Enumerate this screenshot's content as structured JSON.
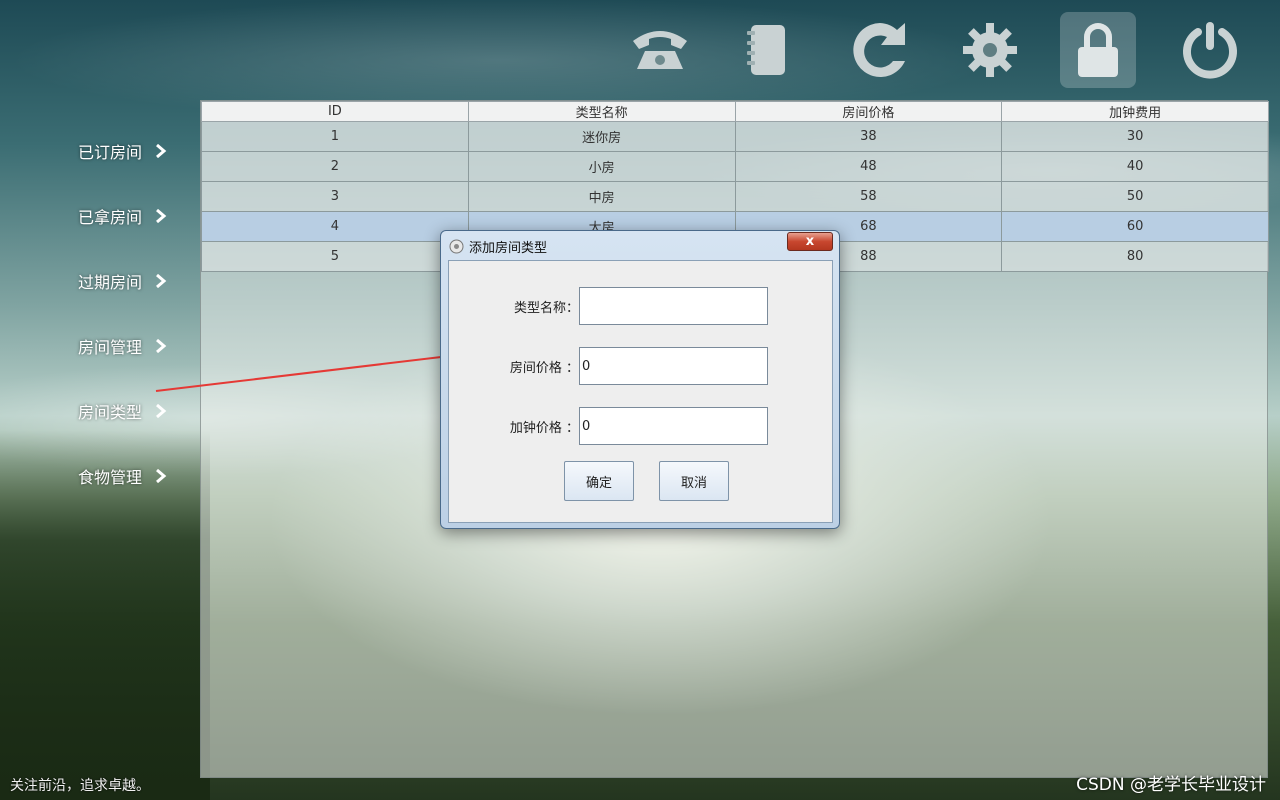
{
  "toolbar": {
    "icons": [
      "phone-icon",
      "notebook-icon",
      "refresh-icon",
      "gear-icon",
      "lock-icon",
      "power-icon"
    ],
    "active": "lock-icon"
  },
  "sidebar": {
    "items": [
      {
        "label": "已订房间"
      },
      {
        "label": "已拿房间"
      },
      {
        "label": "过期房间"
      },
      {
        "label": "房间管理"
      },
      {
        "label": "房间类型"
      },
      {
        "label": "食物管理"
      }
    ]
  },
  "table": {
    "headers": [
      "ID",
      "类型名称",
      "房间价格",
      "加钟费用"
    ],
    "rows": [
      [
        "1",
        "迷你房",
        "38",
        "30"
      ],
      [
        "2",
        "小房",
        "48",
        "40"
      ],
      [
        "3",
        "中房",
        "58",
        "50"
      ],
      [
        "4",
        "大房",
        "68",
        "60"
      ],
      [
        "5",
        "",
        "88",
        "80"
      ]
    ],
    "selected_row": 4
  },
  "dialog": {
    "title": "添加房间类型",
    "close_label": "x",
    "fields": [
      {
        "label": "类型名称：",
        "value": ""
      },
      {
        "label": "房间价格 ：",
        "value": "0"
      },
      {
        "label": "加钟价格 ：",
        "value": "0"
      }
    ],
    "ok_label": "确定",
    "cancel_label": "取消"
  },
  "status_text": "关注前沿，追求卓越。",
  "watermark": "CSDN @老学长毕业设计",
  "colors": {
    "selected_row": "#b8cfe5",
    "annotation_arrow": "#e53935"
  }
}
